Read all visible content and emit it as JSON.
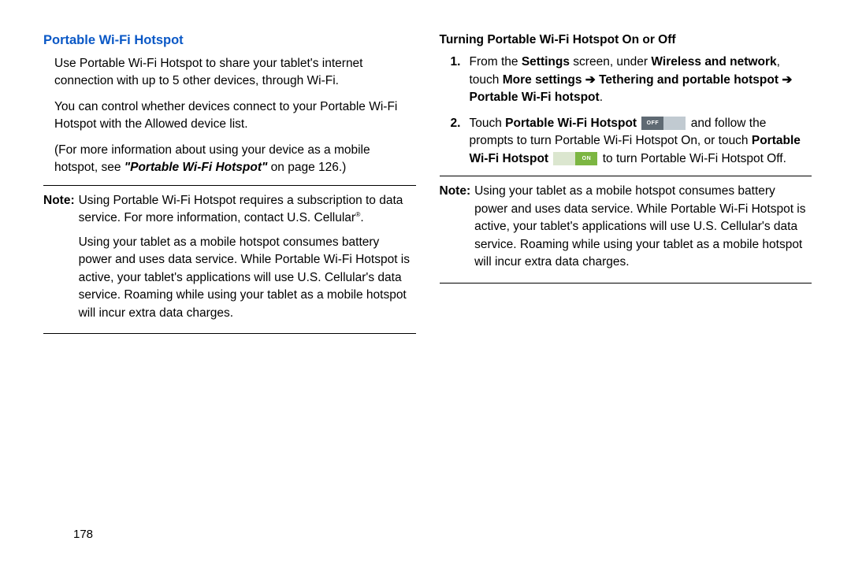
{
  "page_number": "178",
  "left": {
    "title": "Portable Wi-Fi Hotspot",
    "p1": "Use Portable Wi-Fi Hotspot to share your tablet's internet connection with up to 5 other devices, through Wi-Fi.",
    "p2": "You can control whether devices connect to your Portable Wi-Fi Hotspot with the Allowed device list.",
    "p3_a": "(For more information about using your device as a mobile hotspot, see ",
    "p3_ref": "\"Portable Wi-Fi Hotspot\"",
    "p3_b": " on page 126.)",
    "note_label": "Note:",
    "note_p1_a": "Using Portable Wi-Fi Hotspot requires a subscription to data service. For more information, contact U.S. Cellular",
    "note_p1_sup": "®",
    "note_p1_b": ".",
    "note_p2": "Using your tablet as a mobile hotspot consumes battery power and uses data service. While Portable Wi-Fi Hotspot is active, your tablet's applications will use U.S. Cellular's data service. Roaming while using your tablet as a mobile hotspot will incur extra data charges."
  },
  "right": {
    "subhead": "Turning Portable Wi-Fi Hotspot On or Off",
    "step1": {
      "a": "From the ",
      "settings": "Settings",
      "b": " screen, under ",
      "wireless": "Wireless and network",
      "c": ", touch ",
      "more": "More settings",
      "arrow": " ➔ ",
      "tether": "Tethering and portable hotspot",
      "arrow2": " ➔ ",
      "portable": "Portable Wi-Fi hotspot",
      "d": "."
    },
    "step2": {
      "a": "Touch ",
      "pwh1": "Portable Wi-Fi Hotspot",
      "off_label": "OFF",
      "b": " and follow the prompts to turn Portable Wi-Fi Hotspot On, or touch ",
      "pwh2": "Portable Wi-Fi Hotspot",
      "on_label": "ON",
      "c": " to turn Portable Wi-Fi Hotspot Off."
    },
    "note_label": "Note:",
    "note_p": "Using your tablet as a mobile hotspot consumes battery power and uses data service. While Portable Wi-Fi Hotspot is active, your tablet's applications will use U.S. Cellular's data service. Roaming while using your tablet as a mobile hotspot will incur extra data charges."
  }
}
